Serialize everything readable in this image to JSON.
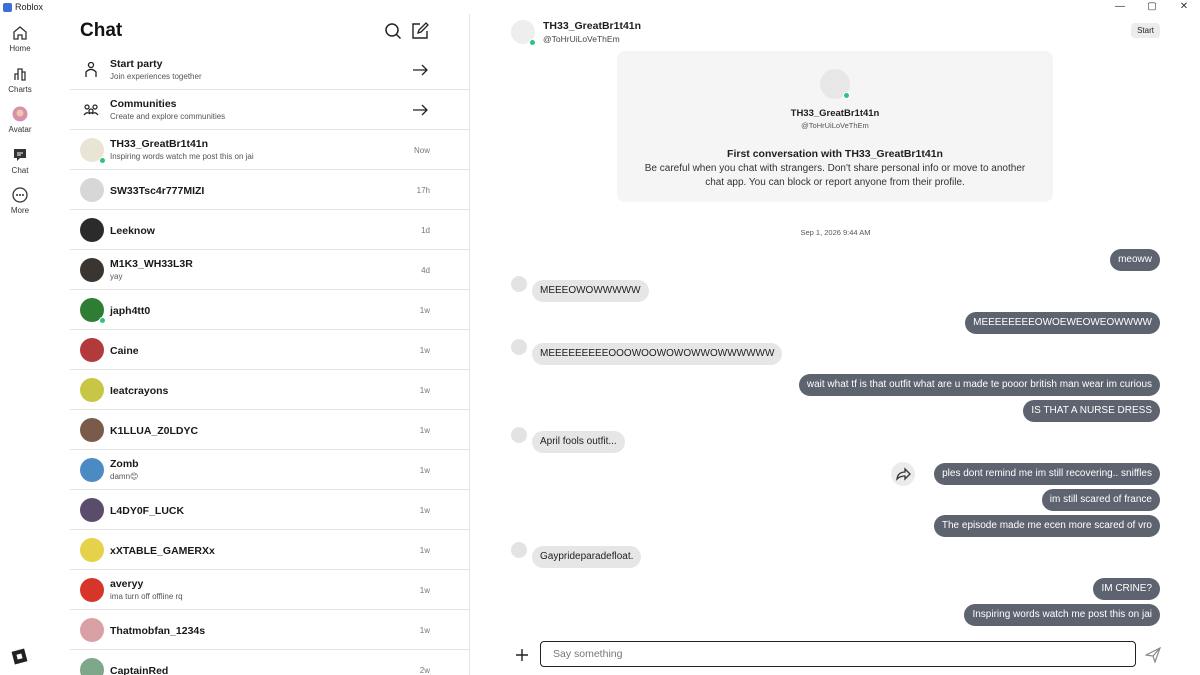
{
  "window": {
    "title": "Roblox",
    "controls": [
      "—",
      "▢",
      "✕"
    ]
  },
  "rail": [
    {
      "label": "Home",
      "icon": "home-icon"
    },
    {
      "label": "Charts",
      "icon": "charts-icon"
    },
    {
      "label": "Avatar",
      "icon": "avatar-icon"
    },
    {
      "label": "Chat",
      "icon": "chat-icon"
    },
    {
      "label": "More",
      "icon": "more-icon"
    }
  ],
  "list": {
    "title": "Chat",
    "actions": [
      {
        "name": "Start party",
        "sub": "Join experiences together",
        "icon": "party-icon"
      },
      {
        "name": "Communities",
        "sub": "Create and explore communities",
        "icon": "communities-icon"
      }
    ],
    "chats": [
      {
        "name": "TH33_GreatBr1t41n",
        "sub": "Inspiring words watch me post this on jai",
        "time": "Now",
        "online": true,
        "color": "#e9e4d4"
      },
      {
        "name": "SW33Tsc4r777MIZI",
        "sub": "",
        "time": "17h",
        "online": false,
        "color": "#d7d7d7"
      },
      {
        "name": "Leeknow",
        "sub": "",
        "time": "1d",
        "online": false,
        "color": "#2b2b2b"
      },
      {
        "name": "M1K3_WH33L3R",
        "sub": "yay",
        "time": "4d",
        "online": false,
        "color": "#3a3530"
      },
      {
        "name": "japh4tt0",
        "sub": "",
        "time": "1w",
        "online": true,
        "color": "#2f7d35"
      },
      {
        "name": "Caine",
        "sub": "",
        "time": "1w",
        "online": false,
        "color": "#b23a3a"
      },
      {
        "name": "Ieatcrayons",
        "sub": "",
        "time": "1w",
        "online": false,
        "color": "#c8c645"
      },
      {
        "name": "K1LLUA_Z0LDYC",
        "sub": "",
        "time": "1w",
        "online": false,
        "color": "#7a5a48"
      },
      {
        "name": "Zomb",
        "sub": "damn😊",
        "time": "1w",
        "online": false,
        "color": "#4c8ac4"
      },
      {
        "name": "L4DY0F_LUCK",
        "sub": "",
        "time": "1w",
        "online": false,
        "color": "#5a4d6b"
      },
      {
        "name": "xXTABLE_GAMERXx",
        "sub": "",
        "time": "1w",
        "online": false,
        "color": "#e6d14a"
      },
      {
        "name": "averyy",
        "sub": "ima turn off offline rq",
        "time": "1w",
        "online": false,
        "color": "#d6352a"
      },
      {
        "name": "Thatmobfan_1234s",
        "sub": "",
        "time": "1w",
        "online": false,
        "color": "#d9a0a6"
      },
      {
        "name": "CaptainRed",
        "sub": "",
        "time": "2w",
        "online": false,
        "color": "#7fa88a"
      }
    ]
  },
  "conversation": {
    "name": "TH33_GreatBr1t41n",
    "username": "@ToHrUiLoVeThEm",
    "start_label": "Start",
    "intro_title": "First conversation with TH33_GreatBr1t41n",
    "intro_body": "Be careful when you chat with strangers. Don't share personal info or move to another chat app. You can block or report anyone from their profile.",
    "date": "Sep 1, 2026 9:44 AM",
    "messages": [
      {
        "dir": "out",
        "text": "meoww"
      },
      {
        "dir": "in",
        "text": "MEEEOWOWWWWW"
      },
      {
        "dir": "out",
        "text": "MEEEEEEEEOWOEWEOWEOWWWW"
      },
      {
        "dir": "in",
        "text": "MEEEEEEEEEOOOWOOWOWOWWOWWWWWW"
      },
      {
        "dir": "out",
        "text": "wait what tf is that outfit what are u made te pooor british man wear im curious"
      },
      {
        "dir": "out",
        "text": "IS THAT A  NURSE DRESS"
      },
      {
        "dir": "in",
        "text": "April fools outfit..."
      },
      {
        "dir": "out",
        "text": "ples dont remind me im still recovering.. sniffles"
      },
      {
        "dir": "out",
        "text": "im still scared of france"
      },
      {
        "dir": "out",
        "text": "The episode made me ecen more scared of vro"
      },
      {
        "dir": "in",
        "text": "Gayprideparadefloat."
      },
      {
        "dir": "out",
        "text": "IM CRINE?"
      },
      {
        "dir": "out",
        "text": "Inspiring words watch me post this on jai"
      }
    ],
    "composer_placeholder": "Say something"
  }
}
